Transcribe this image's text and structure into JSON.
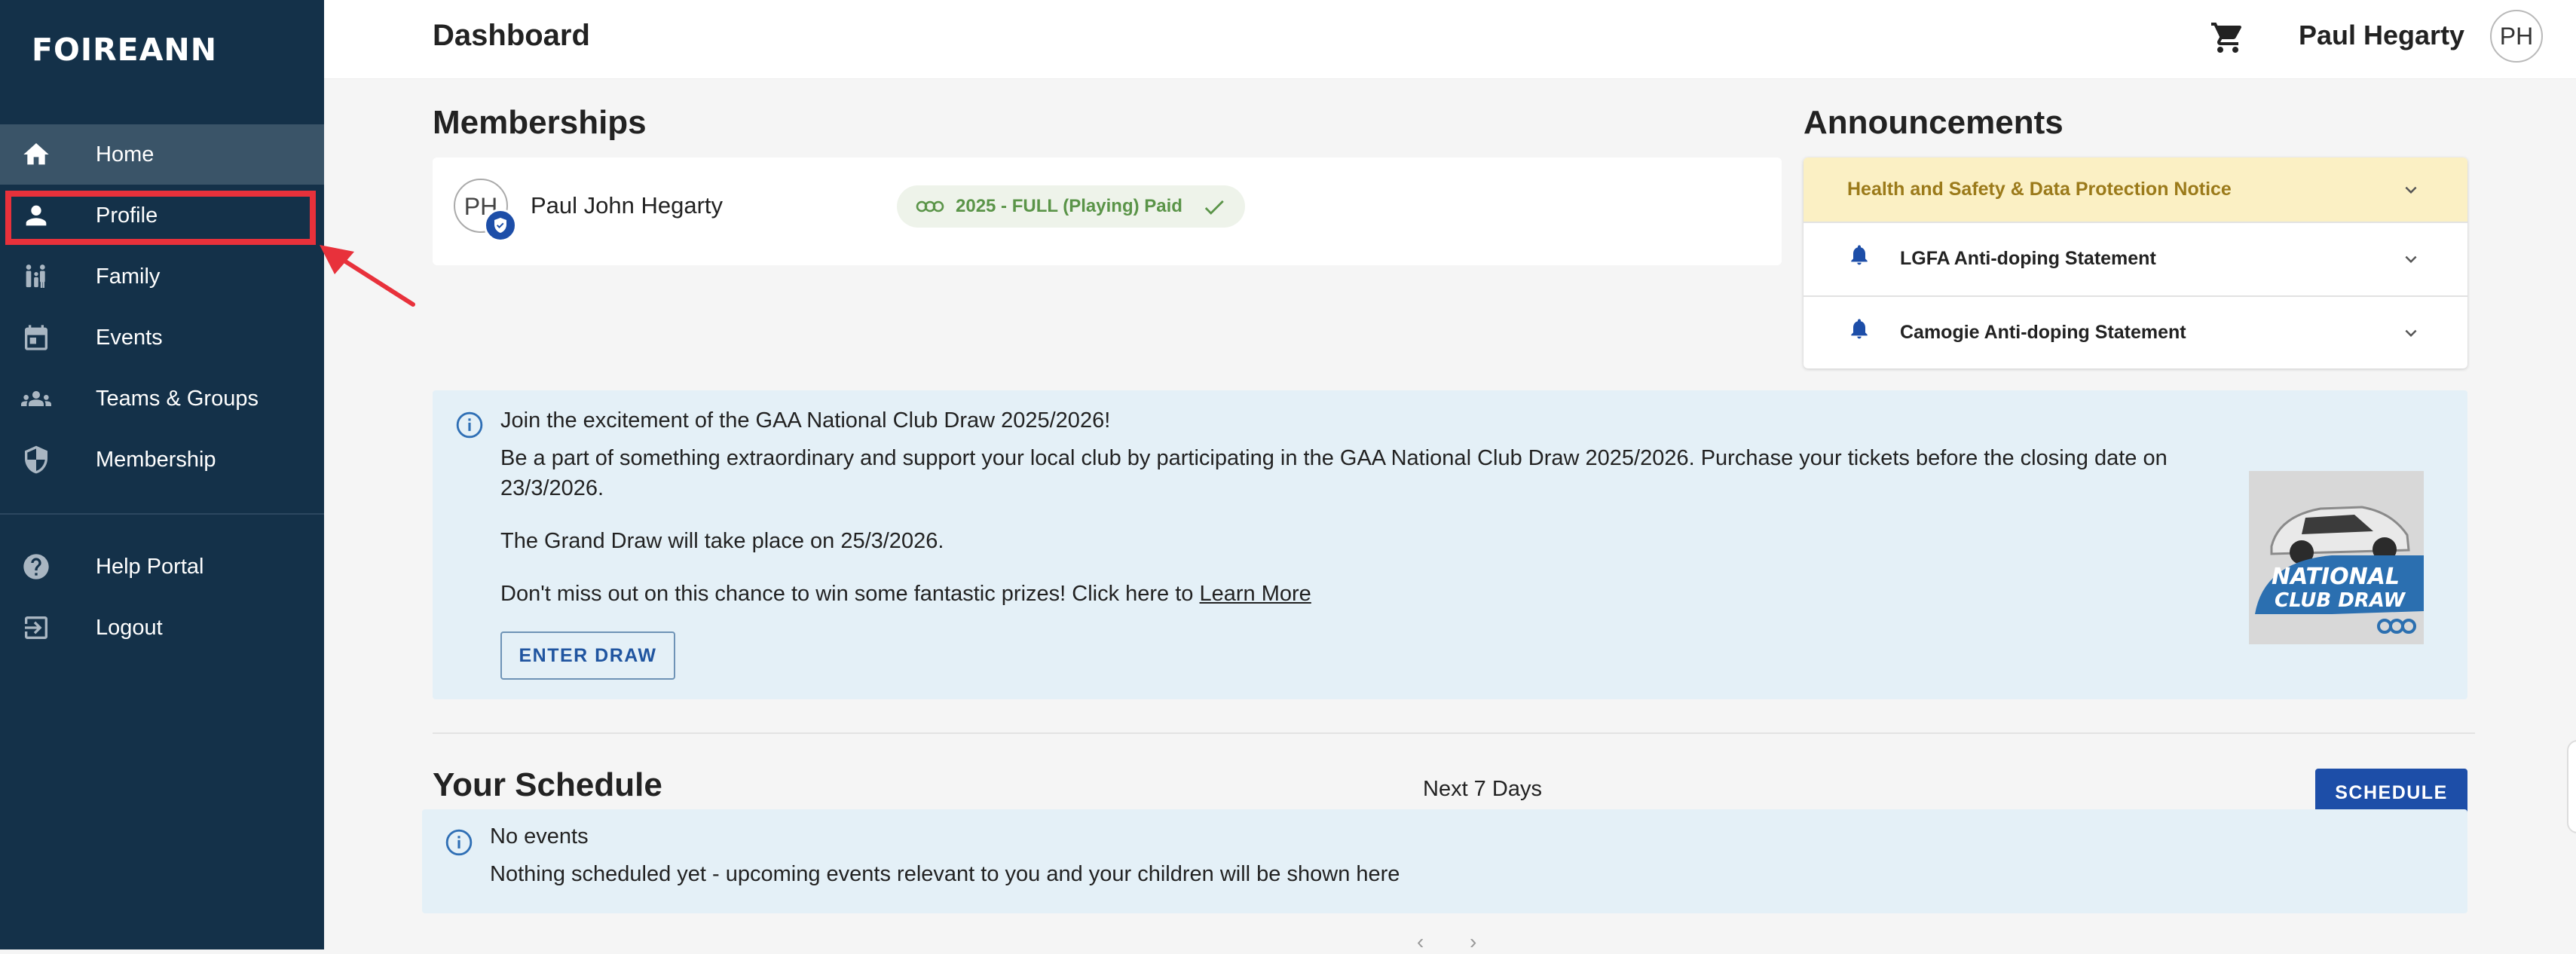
{
  "app": {
    "logo": "FOIREANN"
  },
  "sidebar": {
    "items": [
      {
        "label": "Home",
        "icon": "home-icon"
      },
      {
        "label": "Profile",
        "icon": "person-icon"
      },
      {
        "label": "Family",
        "icon": "family-icon"
      },
      {
        "label": "Events",
        "icon": "calendar-icon"
      },
      {
        "label": "Teams & Groups",
        "icon": "groups-icon"
      },
      {
        "label": "Membership",
        "icon": "shield-icon"
      }
    ],
    "secondary": [
      {
        "label": "Help Portal",
        "icon": "help-icon"
      },
      {
        "label": "Logout",
        "icon": "logout-icon"
      }
    ],
    "active_item": "Home",
    "highlighted_item": "Profile",
    "highlight_color": "#e8313b"
  },
  "header": {
    "title": "Dashboard",
    "cart_icon": "cart-icon",
    "user_name": "Paul Hegarty",
    "user_initials": "PH"
  },
  "memberships": {
    "title": "Memberships",
    "card": {
      "initials": "PH",
      "name": "Paul John Hegarty",
      "status": "2025 - FULL (Playing) Paid",
      "status_icon": "check-icon"
    }
  },
  "announcements": {
    "title": "Announcements",
    "items": [
      {
        "title": "Health and Safety & Data Protection Notice"
      },
      {
        "title": "LGFA Anti-doping Statement",
        "icon": "bell-icon"
      },
      {
        "title": "Camogie Anti-doping Statement",
        "icon": "bell-icon"
      }
    ]
  },
  "promo": {
    "heading": "Join the excitement of the GAA National Club Draw 2025/2026!",
    "line1": "Be a part of something extraordinary and support your local club by participating in the GAA National Club Draw 2025/2026. Purchase your tickets before the closing date on 23/3/2026.",
    "line2": "The Grand Draw will take place on 25/3/2026.",
    "line3": "Don't miss out on this chance to win some fantastic prizes! Click here to",
    "link": "Learn More",
    "button": "ENTER DRAW",
    "image_text_1": "NATIONAL",
    "image_text_2": "CLUB DRAW"
  },
  "schedule": {
    "title": "Your Schedule",
    "range": "Next 7 Days",
    "button": "SCHEDULE",
    "empty_title": "No events",
    "empty_text": "Nothing scheduled yet - upcoming events relevant to you and your children will be shown here",
    "prev": "‹",
    "next": "›"
  },
  "colors": {
    "sidebar_bg": "#143149",
    "accent": "#1d4ea8",
    "info_bg": "#e4f0f7",
    "status_green": "#5a9448",
    "announcement_highlight": "#fbf0c4"
  }
}
